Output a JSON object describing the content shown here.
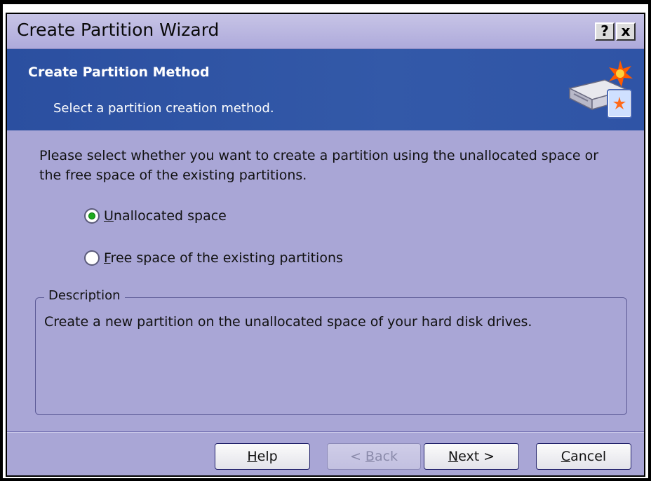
{
  "window": {
    "title": "Create Partition Wizard",
    "help_glyph": "?",
    "close_glyph": "x"
  },
  "header": {
    "title": "Create Partition Method",
    "subtitle": "Select a partition creation method.",
    "icon": "disk-wizard-icon"
  },
  "content": {
    "intro": "Please select whether you want to create a partition using the unallocated space or the free space of the existing partitions.",
    "options": [
      {
        "label_first": "U",
        "label_rest": "nallocated space",
        "checked": true
      },
      {
        "label_first": "F",
        "label_rest": "ree space of the existing partitions",
        "checked": false
      }
    ],
    "description": {
      "legend": "Description",
      "text": "Create a new partition on the unallocated space of your hard disk drives."
    }
  },
  "buttons": {
    "help": {
      "first": "H",
      "rest": "elp"
    },
    "back": {
      "prefix": "< ",
      "first": "B",
      "rest": "ack",
      "enabled": false
    },
    "next": {
      "first": "N",
      "rest": "ext >"
    },
    "cancel": {
      "first": "C",
      "rest": "ancel"
    }
  },
  "colors": {
    "header_bg": "#2f54a6",
    "dialog_bg": "#a9a6d6",
    "radio_selected": "#1faa1f"
  }
}
